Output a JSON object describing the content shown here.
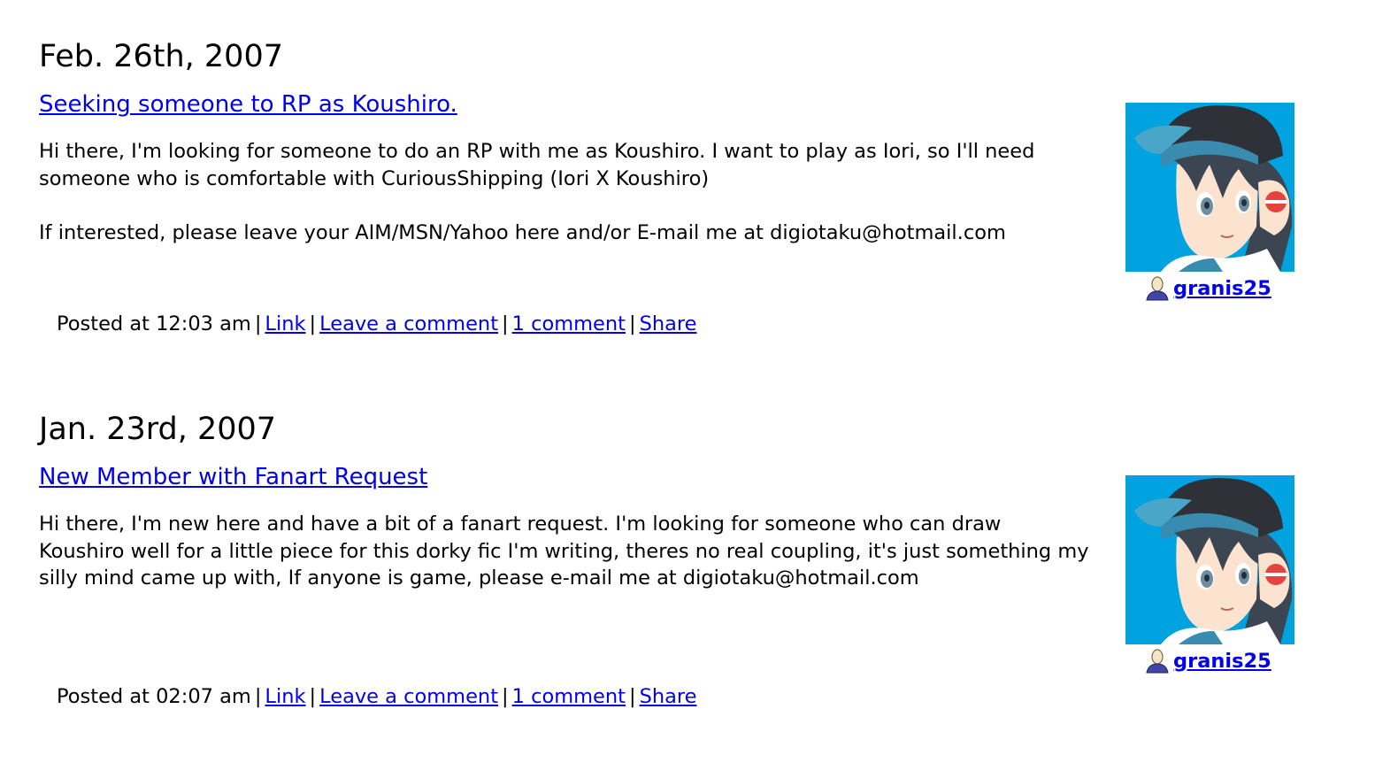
{
  "entries": [
    {
      "date": "Feb. 26th, 2007",
      "subject": "Seeking someone to RP as Koushiro.",
      "paragraphs": [
        "Hi there, I'm looking for someone to do an RP with me as Koushiro. I want to play as Iori, so I'll need someone who is comfortable with CuriousShipping (Iori X Koushiro)",
        "If interested, please leave your AIM/MSN/Yahoo here and/or E-mail me at digiotaku@hotmail.com"
      ],
      "posted": "Posted at 12:03 am",
      "link_label": "Link",
      "leave_comment_label": "Leave a comment",
      "comments_label": "1 comment",
      "share_label": "Share",
      "username": "granis25"
    },
    {
      "date": "Jan. 23rd, 2007",
      "subject": "New Member with Fanart Request",
      "paragraphs": [
        "Hi there, I'm new here and have a bit of a fanart request. I'm looking for someone who can draw Koushiro well for a little piece for this dorky fic I'm writing, theres no real coupling, it's just something my silly mind came up with, If anyone is game, please e-mail me at digiotaku@hotmail.com"
      ],
      "posted": "Posted at 02:07 am",
      "link_label": "Link",
      "leave_comment_label": "Leave a comment",
      "comments_label": "1 comment",
      "share_label": "Share",
      "username": "granis25"
    }
  ],
  "icons": {
    "user": "user-head-icon",
    "userpic": "userpic-avatar"
  },
  "colors": {
    "link": "#0000ee",
    "userpic_bg": "#00a2e0"
  }
}
